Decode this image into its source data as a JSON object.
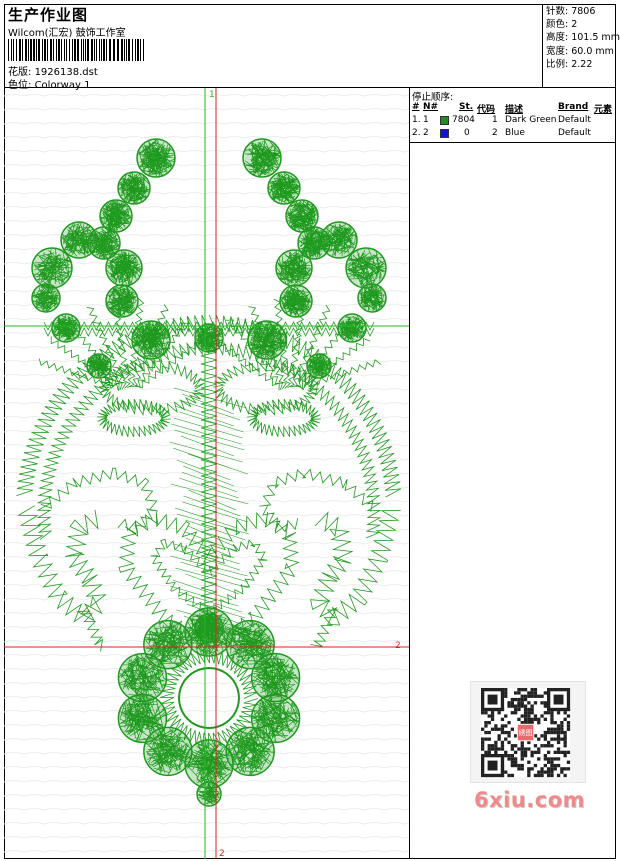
{
  "header": {
    "title": "生产作业图",
    "company": "Wilcom(汇宏) 鼓饰工作室",
    "design_label": "花版:",
    "design_value": "1926138.dst",
    "color_label": "色位:",
    "color_value": "Colorway 1"
  },
  "stats": {
    "stitches": "针数: 7806",
    "colors": "颜色: 2",
    "height": "高度: 101.5 mm",
    "width": "宽度: 60.0 mm",
    "scale": "比例: 2.22"
  },
  "stop_order": {
    "title": "停止顺序:",
    "headers": {
      "hash": "#",
      "n": "N#",
      "st": "St.",
      "code": "代码",
      "desc": "描述",
      "brand": "Brand",
      "elements": "元素"
    },
    "rows": [
      {
        "hash": "1.",
        "n": "1",
        "color": "#1f8f1f",
        "st": "7804",
        "code": "1",
        "desc": "Dark Green",
        "brand": "Default"
      },
      {
        "hash": "2.",
        "n": "2",
        "color": "#1010e0",
        "st": "0",
        "code": "2",
        "desc": "Blue",
        "brand": "Default"
      }
    ]
  },
  "guides": {
    "marker_top": "1",
    "marker_right": "2",
    "marker_bottom": "2",
    "green": "#22bb22",
    "red": "#dd2222"
  },
  "stitch_color": "#1f9a1f",
  "watermark": {
    "text": "6xiu.com",
    "qr_badge": "绣图"
  }
}
